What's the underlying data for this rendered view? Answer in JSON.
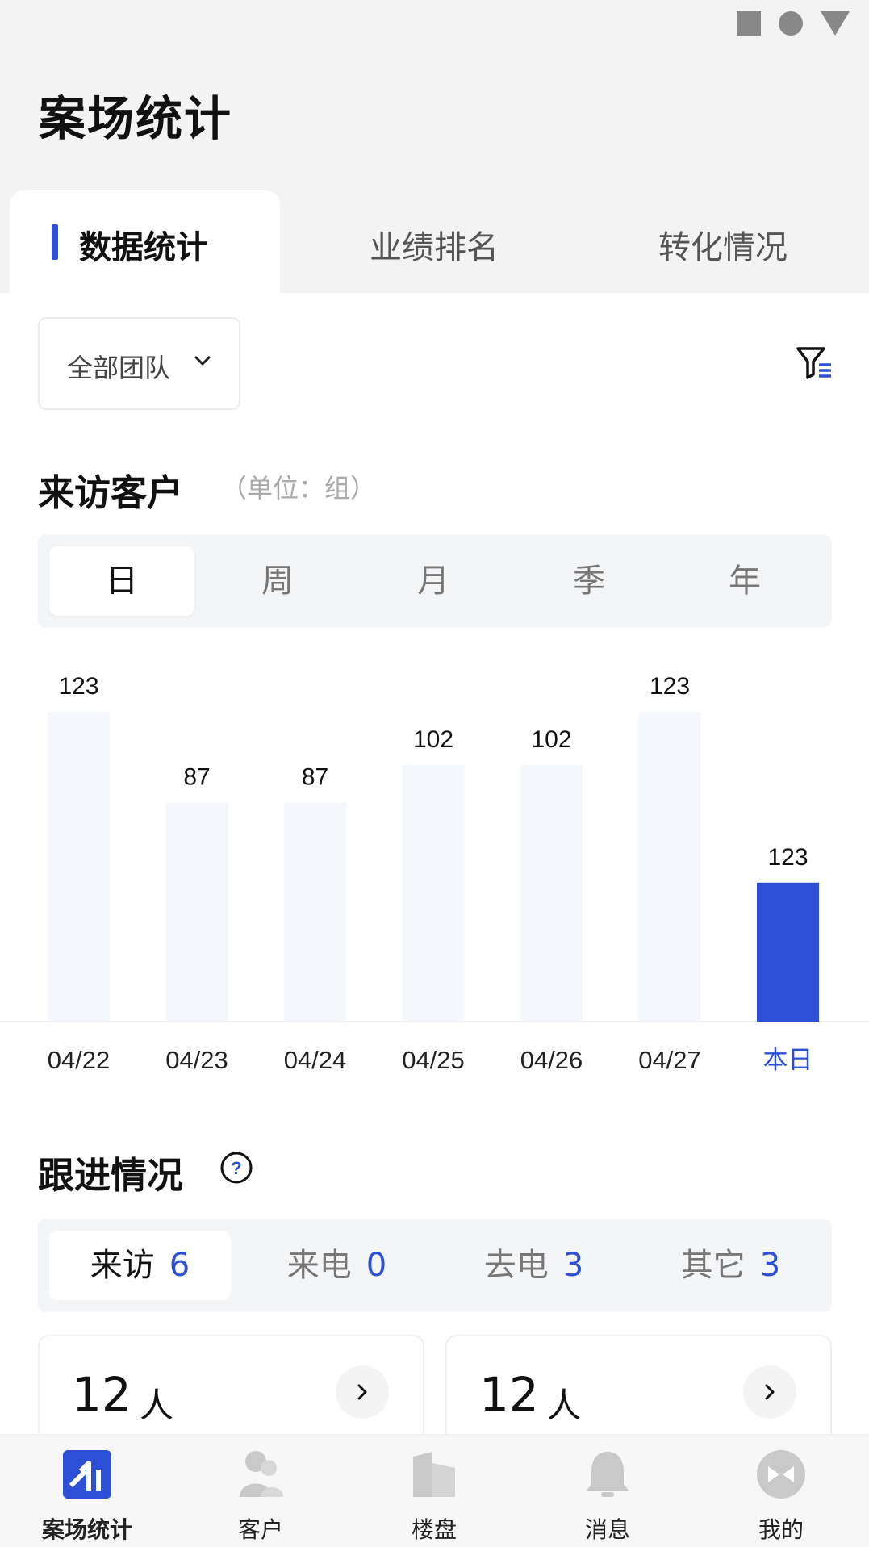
{
  "page": {
    "title": "案场统计"
  },
  "tabs": [
    {
      "label": "数据统计",
      "active": true
    },
    {
      "label": "业绩排名",
      "active": false
    },
    {
      "label": "转化情况",
      "active": false
    }
  ],
  "team_select": {
    "value": "全部团队",
    "icon": "chevron-down-icon"
  },
  "filter": {
    "icon": "filter-list-icon"
  },
  "visit_section": {
    "title": "来访客户",
    "unit": "（单位：组）",
    "periods": [
      "日",
      "周",
      "月",
      "季",
      "年"
    ],
    "active_period": "日"
  },
  "chart_data": {
    "type": "bar",
    "categories": [
      "04/22",
      "04/23",
      "04/24",
      "04/25",
      "04/26",
      "04/27",
      "本日"
    ],
    "values": [
      123,
      87,
      87,
      102,
      102,
      123,
      123
    ],
    "highlight_index": 6,
    "colors": {
      "normal": "#f4f7fc",
      "highlight": "#2d4fd6",
      "highlight_label": "#2d4fd6"
    }
  },
  "follow_section": {
    "title": "跟进情况",
    "help_icon": "question-circle-icon",
    "items": [
      {
        "label": "来访",
        "count": "6",
        "active": true
      },
      {
        "label": "来电",
        "count": "0",
        "active": false
      },
      {
        "label": "去电",
        "count": "3",
        "active": false
      },
      {
        "label": "其它",
        "count": "3",
        "active": false
      }
    ]
  },
  "cards": [
    {
      "value": "12",
      "unit": "人",
      "icon": "chevron-right-icon"
    },
    {
      "value": "12",
      "unit": "人",
      "icon": "chevron-right-icon"
    }
  ],
  "bottom_nav": [
    {
      "label": "案场统计",
      "icon": "stats-icon",
      "active": true
    },
    {
      "label": "客户",
      "icon": "customers-icon",
      "active": false
    },
    {
      "label": "楼盘",
      "icon": "building-icon",
      "active": false
    },
    {
      "label": "消息",
      "icon": "bell-icon",
      "active": false
    },
    {
      "label": "我的",
      "icon": "profile-icon",
      "active": false
    }
  ],
  "colors": {
    "accent": "#2d4fd6"
  }
}
